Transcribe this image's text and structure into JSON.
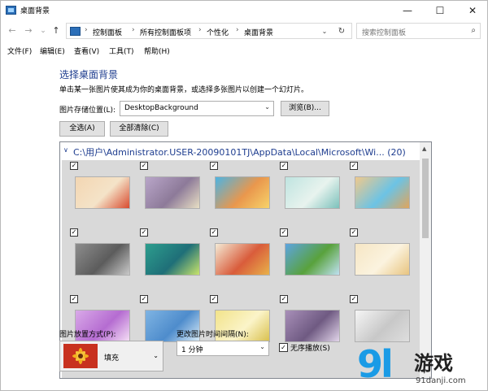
{
  "window": {
    "title": "桌面背景",
    "minimize": "—",
    "maximize": "☐",
    "close": "✕"
  },
  "nav": {
    "back": "←",
    "forward": "→",
    "recent": "⌄",
    "up": "↑"
  },
  "address": {
    "crumbs": [
      "控制面板",
      "所有控制面板项",
      "个性化",
      "桌面背景"
    ],
    "separator": "›",
    "dropdown": "⌄",
    "refresh": "↻"
  },
  "search": {
    "placeholder": "搜索控制面板",
    "icon": "⌕"
  },
  "menu": [
    "文件(F)",
    "编辑(E)",
    "查看(V)",
    "工具(T)",
    "帮助(H)"
  ],
  "main": {
    "heading": "选择桌面背景",
    "description": "单击某一张图片使其成为你的桌面背景，或选择多张图片以创建一个幻灯片。",
    "location_label": "图片存储位置(L):",
    "location_value": "DesktopBackground",
    "browse_button": "浏览(B)...",
    "select_all_button": "全选(A)",
    "clear_all_button": "全部清除(C)"
  },
  "gallery": {
    "expand_icon": "∨",
    "path": "C:\\用户\\Administrator.USER-20090101TJ\\AppData\\Local\\Microsoft\\Wi... (20)",
    "check_mark": "✓",
    "thumbnails": [
      {
        "name": "red-cartoon",
        "colors": [
          "#f3d6b2",
          "#d84b2f",
          "#f4e3c8"
        ],
        "checked": true
      },
      {
        "name": "power-lines",
        "colors": [
          "#b9a6c9",
          "#e8dfc4",
          "#8d7a99"
        ],
        "checked": true
      },
      {
        "name": "beach-cartoon",
        "colors": [
          "#4cb4e3",
          "#f7d36a",
          "#e9974d"
        ],
        "checked": true
      },
      {
        "name": "teal-swing",
        "colors": [
          "#bfe4e0",
          "#7cc1bb",
          "#e8f3ee"
        ],
        "checked": true
      },
      {
        "name": "sand-heart",
        "colors": [
          "#f0c98c",
          "#e0a55c",
          "#6cc3e5"
        ],
        "checked": true
      },
      {
        "name": "gray-scene",
        "colors": [
          "#8d8d8d",
          "#c9c9c9",
          "#5c5c5c"
        ],
        "checked": true
      },
      {
        "name": "green-dew",
        "colors": [
          "#2d9e8e",
          "#c9e46b",
          "#1f6f78"
        ],
        "checked": true
      },
      {
        "name": "flowers-cream",
        "colors": [
          "#f4ead5",
          "#e8b24a",
          "#d95c3b"
        ],
        "checked": true
      },
      {
        "name": "green-field",
        "colors": [
          "#5da4e0",
          "#bfe1f2",
          "#59a23c"
        ],
        "checked": true
      },
      {
        "name": "sunny-beach",
        "colors": [
          "#f6e6c4",
          "#e8c47f",
          "#fbf3df"
        ],
        "checked": true
      },
      {
        "name": "purple-flower",
        "colors": [
          "#d9a9e8",
          "#f5dff5",
          "#b56cd1"
        ],
        "checked": true
      },
      {
        "name": "blue-sky",
        "colors": [
          "#7fb4e3",
          "#d9ecf8",
          "#4e8ccc"
        ],
        "checked": true
      },
      {
        "name": "yellow-field",
        "colors": [
          "#f2e38a",
          "#d9c04d",
          "#fbf4c9"
        ],
        "checked": true
      },
      {
        "name": "lavender",
        "colors": [
          "#a88fb8",
          "#e2d5ea",
          "#6f5a82"
        ],
        "checked": true
      },
      {
        "name": "white-light",
        "colors": [
          "#f5f5f5",
          "#dedede",
          "#c8c8c8"
        ],
        "checked": true
      }
    ]
  },
  "footer": {
    "position_label": "图片放置方式(P):",
    "position_value": "填充",
    "interval_label": "更改图片时间间隔(N):",
    "interval_value": "1 分钟",
    "shuffle_label": "无序播放(S)",
    "combo_arrow": "⌄"
  },
  "watermark": {
    "logo": "9l",
    "text": "游戏",
    "url": "91danji.com"
  }
}
